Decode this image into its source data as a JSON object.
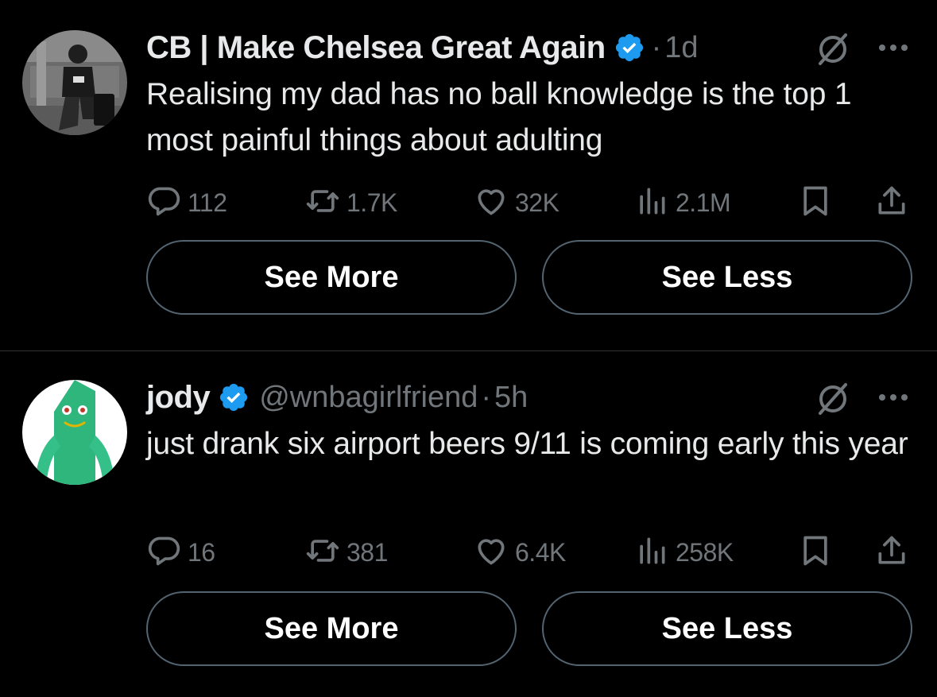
{
  "tweets": [
    {
      "name": "CB | Make Chelsea Great Again",
      "handle": "",
      "dot": "·",
      "time": "1d",
      "text": "Realising my dad has no ball knowledge is the top 1 most painful things about adulting",
      "replies": "112",
      "reposts": "1.7K",
      "likes": "32K",
      "views": "2.1M",
      "see_more_label": "See More",
      "see_less_label": "See Less"
    },
    {
      "name": "jody",
      "handle": "@wnbagirlfriend",
      "dot": "·",
      "time": "5h",
      "text": "just drank six airport beers 9/11 is coming early this year",
      "replies": "16",
      "reposts": "381",
      "likes": "6.4K",
      "views": "258K",
      "see_more_label": "See More",
      "see_less_label": "See Less"
    }
  ],
  "icons": {
    "verified": "verified-badge-icon",
    "grok": "grok-icon",
    "more": "more-options-icon",
    "reply": "reply-icon",
    "repost": "repost-icon",
    "like": "heart-icon",
    "views": "views-chart-icon",
    "bookmark": "bookmark-icon",
    "share": "share-icon"
  },
  "colors": {
    "background": "#000000",
    "text": "#e7e9ea",
    "secondary": "#71767b",
    "verified": "#1d9bf0",
    "button_border": "#536471",
    "divider": "#2f3336"
  }
}
